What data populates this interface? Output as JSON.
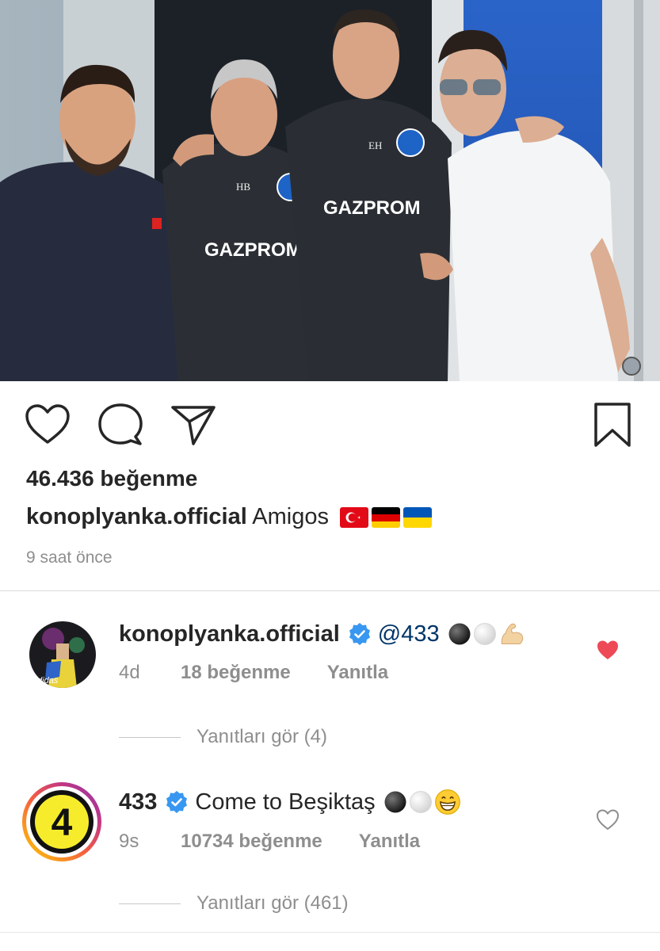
{
  "post": {
    "likes_text": "46.436 beğenme",
    "username": "konoplyanka.official",
    "caption": "Amigos",
    "time_ago": "9 saat önce",
    "flags": [
      "turkey-flag",
      "germany-flag",
      "ukraine-flag"
    ]
  },
  "photo": {
    "shirt_text_1": "GAZPROM",
    "shirt_text_2": "GAZPROM",
    "initials_1": "HB",
    "initials_2": "EH"
  },
  "icons": {
    "like": "heart-outline-icon",
    "comment": "comment-bubble-icon",
    "share": "paper-plane-icon",
    "save": "bookmark-icon"
  },
  "comments": [
    {
      "username": "konoplyanka.official",
      "verified": true,
      "mention": "@433",
      "text": "",
      "emojis": [
        "black-circle",
        "white-circle",
        "flexed-biceps"
      ],
      "time": "4d",
      "likes": "18 beğenme",
      "reply_label": "Yanıtla",
      "liked": true,
      "view_replies": "Yanıtları gör (4)"
    },
    {
      "username": "433",
      "verified": true,
      "mention": "",
      "text": "Come to Beşiktaş",
      "emojis": [
        "black-circle",
        "white-circle",
        "grinning-face"
      ],
      "time": "9s",
      "likes": "10734 beğenme",
      "reply_label": "Yanıtla",
      "liked": false,
      "view_replies": "Yanıtları gör (461)",
      "avatar_text": "4"
    }
  ],
  "colors": {
    "liked_heart": "#ed4956",
    "verified_badge": "#3897f0",
    "mention": "#003569",
    "muted_text": "#8e8e8e"
  }
}
